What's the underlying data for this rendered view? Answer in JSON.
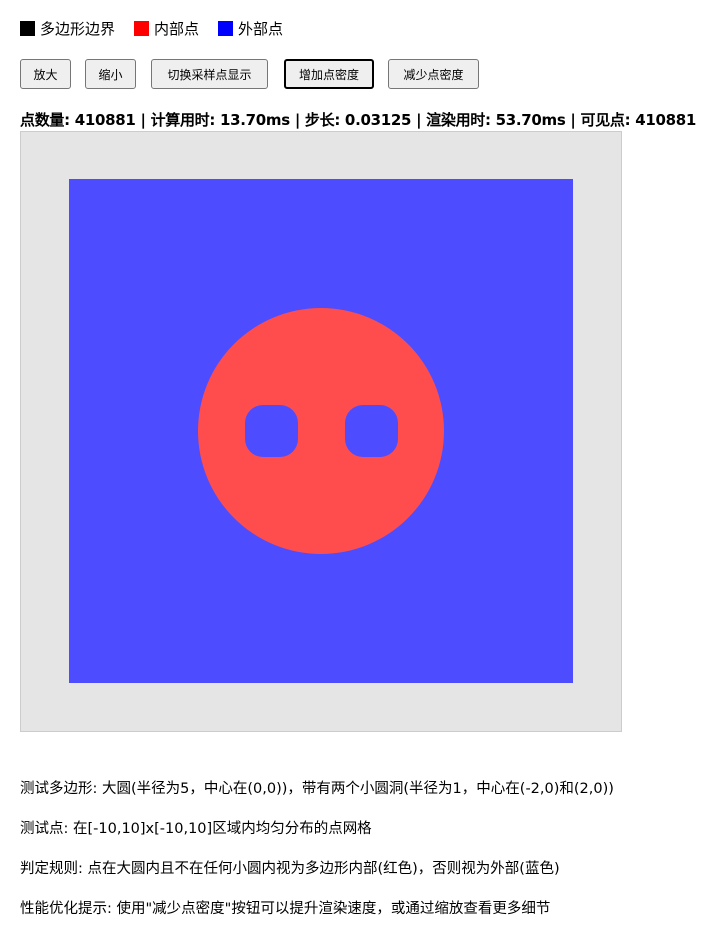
{
  "legend": [
    {
      "label": "多边形边界",
      "color": "#000000"
    },
    {
      "label": "内部点",
      "color": "#ff0000"
    },
    {
      "label": "外部点",
      "color": "#0000ff"
    }
  ],
  "buttons": {
    "zoom_in": "放大",
    "zoom_out": "缩小",
    "toggle_samples": "切换采样点显示",
    "increase_density": "增加点密度",
    "decrease_density": "减少点密度"
  },
  "stats_text": "点数量: 410881 | 计算用时: 13.70ms | 步长: 0.03125 | 渲染用时: 53.70ms | 可见点: 410881",
  "render": {
    "inside_color": "#ff4d4d",
    "outside_color": "#4d4dff",
    "canvas_bg": "#e5e5e5",
    "domain": [
      -10,
      10
    ],
    "outer_circle": {
      "center": [
        0,
        0
      ],
      "radius": 5
    },
    "holes": [
      {
        "center": [
          -2,
          0
        ],
        "radius": 1
      },
      {
        "center": [
          2,
          0
        ],
        "radius": 1
      }
    ]
  },
  "descriptions": {
    "polygon": "测试多边形: 大圆(半径为5，中心在(0,0))，带有两个小圆洞(半径为1，中心在(-2,0)和(2,0))",
    "points": "测试点: 在[-10,10]x[-10,10]区域内均匀分布的点网格",
    "rule": "判定规则: 点在大圆内且不在任何小圆内视为多边形内部(红色)，否则视为外部(蓝色)",
    "tip": "性能优化提示: 使用\"减少点密度\"按钮可以提升渲染速度，或通过缩放查看更多细节"
  }
}
